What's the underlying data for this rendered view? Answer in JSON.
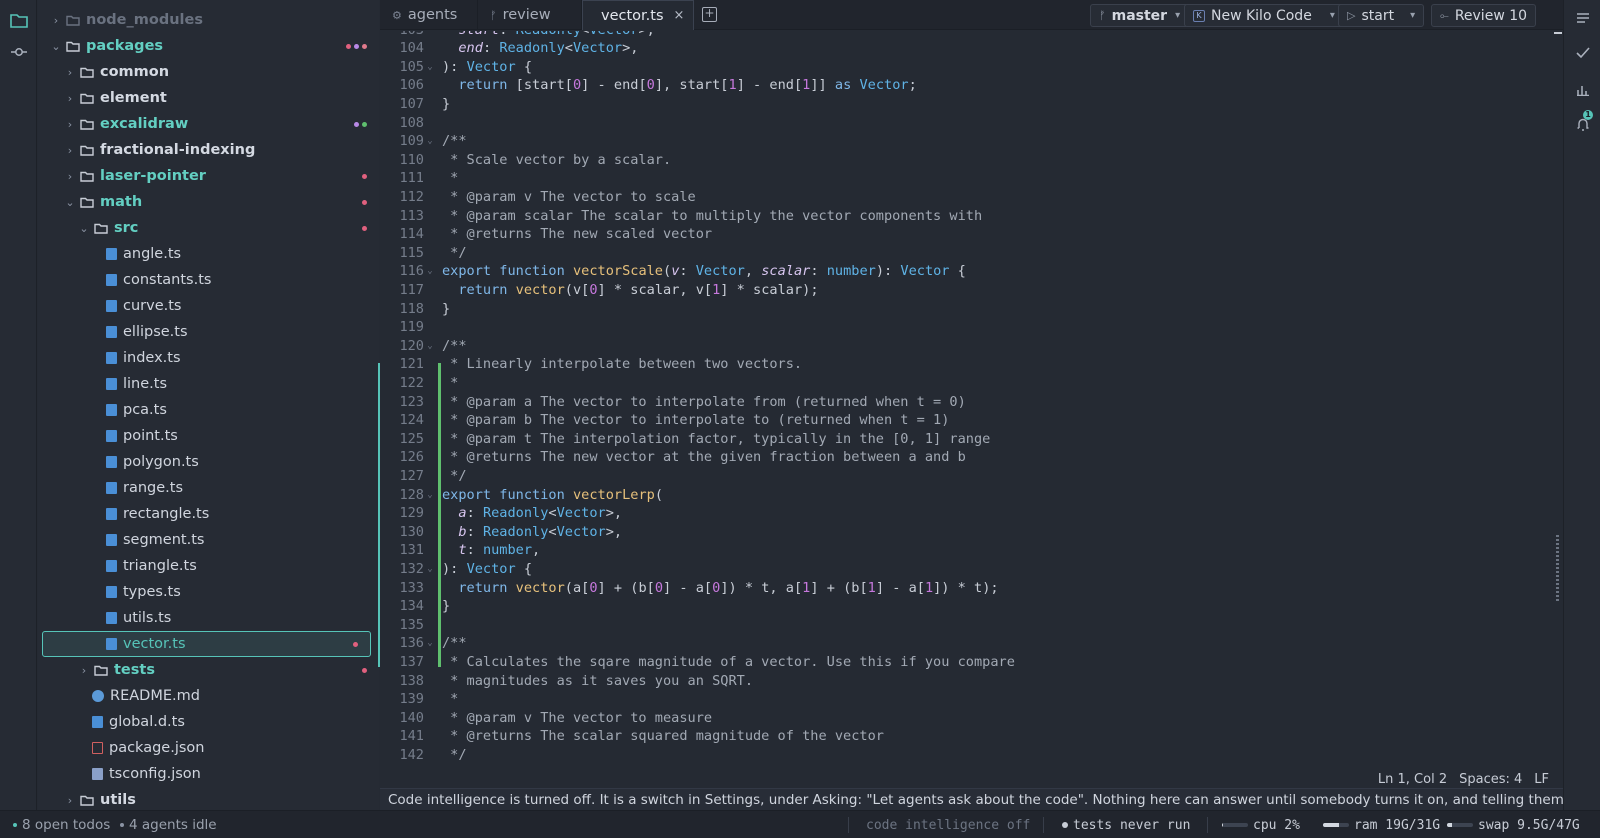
{
  "tree": {
    "items": [
      {
        "label": "node_modules",
        "kind": "folder",
        "depth": 1,
        "open": false,
        "dim": true,
        "dots": []
      },
      {
        "label": "packages",
        "kind": "folder",
        "depth": 1,
        "open": true,
        "dots": [
          "#e0607e",
          "#b889e6",
          "#e07a8c"
        ]
      },
      {
        "label": "common",
        "kind": "folder",
        "depth": 2,
        "open": false,
        "dots": []
      },
      {
        "label": "element",
        "kind": "folder",
        "depth": 2,
        "open": false,
        "dots": []
      },
      {
        "label": "excalidraw",
        "kind": "folder",
        "depth": 2,
        "open": false,
        "dots": [
          "#b889e6",
          "#5fbf6e"
        ]
      },
      {
        "label": "fractional-indexing",
        "kind": "folder",
        "depth": 2,
        "open": false,
        "dots": []
      },
      {
        "label": "laser-pointer",
        "kind": "folder",
        "depth": 2,
        "open": false,
        "dots": [
          "#e0607e"
        ]
      },
      {
        "label": "math",
        "kind": "folder",
        "depth": 2,
        "open": true,
        "dots": [
          "#e0607e"
        ]
      },
      {
        "label": "src",
        "kind": "folder",
        "depth": 3,
        "open": true,
        "dots": [
          "#e0607e"
        ]
      },
      {
        "label": "angle.ts",
        "kind": "ts",
        "depth": 4,
        "dots": []
      },
      {
        "label": "constants.ts",
        "kind": "ts",
        "depth": 4,
        "dots": []
      },
      {
        "label": "curve.ts",
        "kind": "ts",
        "depth": 4,
        "dots": []
      },
      {
        "label": "ellipse.ts",
        "kind": "ts",
        "depth": 4,
        "dots": []
      },
      {
        "label": "index.ts",
        "kind": "ts",
        "depth": 4,
        "dots": []
      },
      {
        "label": "line.ts",
        "kind": "ts",
        "depth": 4,
        "dots": []
      },
      {
        "label": "pca.ts",
        "kind": "ts",
        "depth": 4,
        "dots": []
      },
      {
        "label": "point.ts",
        "kind": "ts",
        "depth": 4,
        "dots": []
      },
      {
        "label": "polygon.ts",
        "kind": "ts",
        "depth": 4,
        "dots": []
      },
      {
        "label": "range.ts",
        "kind": "ts",
        "depth": 4,
        "dots": []
      },
      {
        "label": "rectangle.ts",
        "kind": "ts",
        "depth": 4,
        "dots": []
      },
      {
        "label": "segment.ts",
        "kind": "ts",
        "depth": 4,
        "dots": []
      },
      {
        "label": "triangle.ts",
        "kind": "ts",
        "depth": 4,
        "dots": []
      },
      {
        "label": "types.ts",
        "kind": "ts",
        "depth": 4,
        "dots": []
      },
      {
        "label": "utils.ts",
        "kind": "ts",
        "depth": 4,
        "dots": []
      },
      {
        "label": "vector.ts",
        "kind": "ts",
        "depth": 4,
        "selected": true,
        "dots": [
          "#e0607e"
        ]
      },
      {
        "label": "tests",
        "kind": "folder",
        "depth": 3,
        "open": false,
        "dots": [
          "#e0607e"
        ]
      },
      {
        "label": "README.md",
        "kind": "info",
        "depth": 3,
        "dots": []
      },
      {
        "label": "global.d.ts",
        "kind": "ts",
        "depth": 3,
        "dots": []
      },
      {
        "label": "package.json",
        "kind": "pkg",
        "depth": 3,
        "dots": []
      },
      {
        "label": "tsconfig.json",
        "kind": "cfg",
        "depth": 3,
        "dots": []
      },
      {
        "label": "utils",
        "kind": "folder",
        "depth": 2,
        "open": false,
        "dots": []
      }
    ]
  },
  "tabs": [
    {
      "label": "agents",
      "icon": "gear-icon",
      "active": false
    },
    {
      "label": "review",
      "icon": "branch-icon",
      "active": false
    },
    {
      "label": "vector.ts",
      "icon": "typescript-file-icon",
      "active": true,
      "close": "×"
    }
  ],
  "toolbar": {
    "branch": "master",
    "new_kilo": "New Kilo Code",
    "start": "start",
    "review": "Review 10"
  },
  "editor": {
    "lines": [
      {
        "n": "103",
        "c": "  start: Readonly<Vector>,"
      },
      {
        "n": "104",
        "c": "  end: Readonly<Vector>,"
      },
      {
        "n": "105",
        "c": "): Vector {",
        "fold": true
      },
      {
        "n": "106",
        "c": "  return [start[0] - end[0], start[1] - end[1]] as Vector;"
      },
      {
        "n": "107",
        "c": "}"
      },
      {
        "n": "108",
        "c": ""
      },
      {
        "n": "109",
        "c": "/**",
        "fold": true
      },
      {
        "n": "110",
        "c": " * Scale vector by a scalar."
      },
      {
        "n": "111",
        "c": " *"
      },
      {
        "n": "112",
        "c": " * @param v The vector to scale"
      },
      {
        "n": "113",
        "c": " * @param scalar The scalar to multiply the vector components with"
      },
      {
        "n": "114",
        "c": " * @returns The new scaled vector"
      },
      {
        "n": "115",
        "c": " */"
      },
      {
        "n": "116",
        "c": "export function vectorScale(v: Vector, scalar: number): Vector {",
        "fold": true
      },
      {
        "n": "117",
        "c": "  return vector(v[0] * scalar, v[1] * scalar);"
      },
      {
        "n": "118",
        "c": "}"
      },
      {
        "n": "119",
        "c": ""
      },
      {
        "n": "120",
        "c": "/**",
        "fold": true
      },
      {
        "n": "121",
        "c": " * Linearly interpolate between two vectors."
      },
      {
        "n": "122",
        "c": " *"
      },
      {
        "n": "123",
        "c": " * @param a The vector to interpolate from (returned when t = 0)"
      },
      {
        "n": "124",
        "c": " * @param b The vector to interpolate to (returned when t = 1)"
      },
      {
        "n": "125",
        "c": " * @param t The interpolation factor, typically in the [0, 1] range"
      },
      {
        "n": "126",
        "c": " * @returns The new vector at the given fraction between a and b"
      },
      {
        "n": "127",
        "c": " */"
      },
      {
        "n": "128",
        "c": "export function vectorLerp(",
        "fold": true
      },
      {
        "n": "129",
        "c": "  a: Readonly<Vector>,"
      },
      {
        "n": "130",
        "c": "  b: Readonly<Vector>,"
      },
      {
        "n": "131",
        "c": "  t: number,"
      },
      {
        "n": "132",
        "c": "): Vector {",
        "fold": true
      },
      {
        "n": "133",
        "c": "  return vector(a[0] + (b[0] - a[0]) * t, a[1] + (b[1] - a[1]) * t);"
      },
      {
        "n": "134",
        "c": "}"
      },
      {
        "n": "135",
        "c": ""
      },
      {
        "n": "136",
        "c": "/**",
        "fold": true
      },
      {
        "n": "137",
        "c": " * Calculates the sqare magnitude of a vector. Use this if you compare"
      },
      {
        "n": "138",
        "c": " * magnitudes as it saves you an SQRT."
      },
      {
        "n": "139",
        "c": " *"
      },
      {
        "n": "140",
        "c": " * @param v The vector to measure"
      },
      {
        "n": "141",
        "c": " * @returns The scalar squared magnitude of the vector"
      },
      {
        "n": "142",
        "c": " */"
      }
    ]
  },
  "info": {
    "position": "Ln 1, Col 2",
    "spaces": "Spaces: 4",
    "eol": "LF"
  },
  "notice": "Code intelligence is turned off. It is a switch in Settings, under Asking: \"Let agents ask about the code\". Nothing here can answer until somebody turns it on, and telling them so is the only wa...",
  "status": {
    "todos": "8 open todos",
    "agents": "4 agents idle",
    "code_intel": "code intelligence off",
    "tests": "tests never run",
    "cpu": "cpu 2%",
    "cpu_level": 0.02,
    "ram": "ram 19G/31G",
    "ram_level": 0.61,
    "swap": "swap 9.5G/47G",
    "swap_level": 0.2
  },
  "right_bar": {
    "notification_count": "1"
  }
}
